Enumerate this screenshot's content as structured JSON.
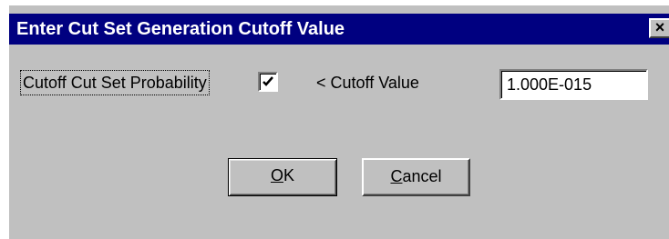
{
  "dialog": {
    "title": "Enter Cut Set Generation Cutoff Value",
    "close_glyph": "×",
    "checkbox_label": "Cutoff Cut Set Probability",
    "checkbox_checked": true,
    "cutoff_label": "< Cutoff Value",
    "cutoff_value": "1.000E-015",
    "ok_mnemonic": "O",
    "ok_rest": "K",
    "cancel_mnemonic": "C",
    "cancel_rest": "ancel"
  },
  "colors": {
    "titlebar": "#000080",
    "face": "#c0c0c0"
  }
}
